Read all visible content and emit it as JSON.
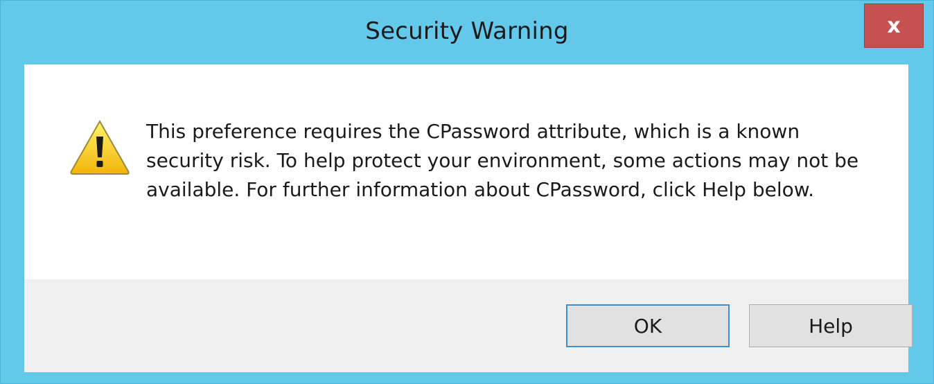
{
  "window": {
    "title": "Security Warning",
    "close_label": "x"
  },
  "dialog": {
    "icon": "warning-icon",
    "message": "This preference requires the CPassword attribute, which is a known security risk. To help protect your environment, some actions may not be available. For further information about CPassword, click Help below."
  },
  "buttons": {
    "ok_label": "OK",
    "help_label": "Help"
  },
  "colors": {
    "titlebar": "#63c8ea",
    "close_button": "#c75050",
    "footer": "#f0f0f0",
    "default_button_border": "#3c8fd1"
  }
}
